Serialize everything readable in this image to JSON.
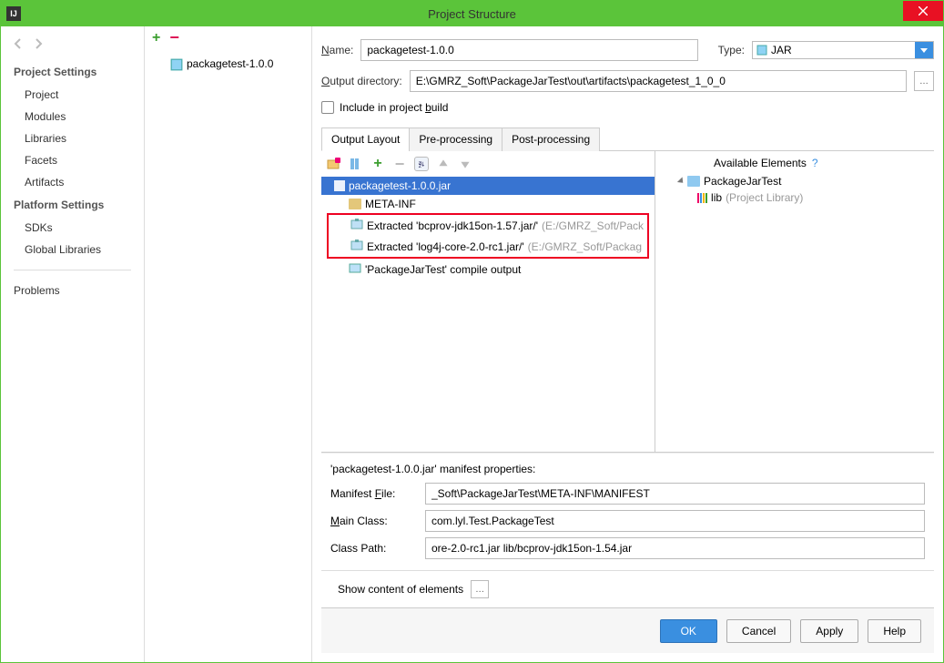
{
  "window": {
    "title": "Project Structure",
    "app_short": "IJ"
  },
  "leftnav": {
    "section1": "Project Settings",
    "items1": [
      "Project",
      "Modules",
      "Libraries",
      "Facets",
      "Artifacts"
    ],
    "section2": "Platform Settings",
    "items2": [
      "SDKs",
      "Global Libraries"
    ],
    "section3_item": "Problems"
  },
  "midlist": {
    "artifact_name": "packagetest-1.0.0"
  },
  "form": {
    "name_label": "Name:",
    "name_value": "packagetest-1.0.0",
    "type_label": "Type:",
    "type_value": "JAR",
    "outdir_label": "Output directory:",
    "outdir_value": "E:\\GMRZ_Soft\\PackageJarTest\\out\\artifacts\\packagetest_1_0_0",
    "include_build": "Include in project build"
  },
  "tabs": {
    "t1": "Output Layout",
    "t2": "Pre-processing",
    "t3": "Post-processing"
  },
  "tree": {
    "root": "packagetest-1.0.0.jar",
    "n1": "META-INF",
    "n2a": "Extracted 'bcprov-jdk15on-1.57.jar/'",
    "n2a_hint": "(E:/GMRZ_Soft/Pack",
    "n2b": "Extracted 'log4j-core-2.0-rc1.jar/'",
    "n2b_hint": "(E:/GMRZ_Soft/Packag",
    "n3": "'PackageJarTest' compile output"
  },
  "available": {
    "title": "Available Elements",
    "help": "?",
    "project": "PackageJarTest",
    "lib": "lib",
    "lib_hint": "(Project Library)"
  },
  "manifest": {
    "heading": "'packagetest-1.0.0.jar' manifest properties:",
    "file_label": "Manifest File:",
    "file_value": "_Soft\\PackageJarTest\\META-INF\\MANIFEST",
    "main_label": "Main Class:",
    "main_value": "com.lyl.Test.PackageTest",
    "cp_label": "Class Path:",
    "cp_value": "ore-2.0-rc1.jar lib/bcprov-jdk15on-1.54.jar"
  },
  "bottom": {
    "show_content": "Show content of elements"
  },
  "footer": {
    "ok": "OK",
    "cancel": "Cancel",
    "apply": "Apply",
    "help": "Help"
  }
}
